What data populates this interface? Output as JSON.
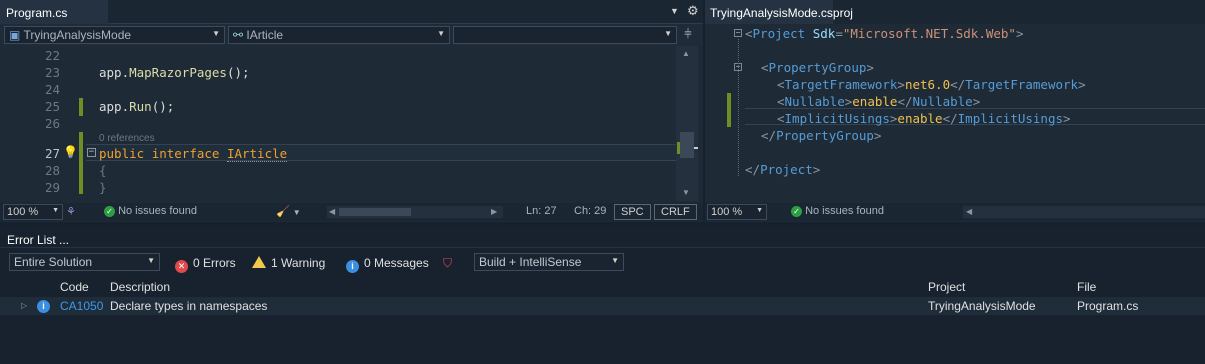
{
  "left_editor": {
    "tab_title": "Program.cs",
    "nav": {
      "project": "TryingAnalysisMode",
      "type": "IArticle",
      "member": ""
    },
    "lines": [
      {
        "num": "22",
        "text": ""
      },
      {
        "num": "23",
        "obj": "app",
        "method": "MapRazorPages",
        "tail": "();"
      },
      {
        "num": "24",
        "text": ""
      },
      {
        "num": "25",
        "obj": "app",
        "method": "Run",
        "tail": "();"
      },
      {
        "num": "26",
        "text": ""
      },
      {
        "num": "27",
        "kw1": "public",
        "kw2": "interface",
        "name": "IArticle"
      },
      {
        "num": "28",
        "text": "{"
      },
      {
        "num": "29",
        "text": "}"
      }
    ],
    "codelens": "0 references",
    "status": {
      "zoom": "100 %",
      "issues": "No issues found",
      "ln": "Ln: 27",
      "ch": "Ch: 29",
      "spc": "SPC",
      "crlf": "CRLF"
    }
  },
  "right_editor": {
    "tab_title": "TryingAnalysisMode.csproj",
    "xml": {
      "project_open_tag": "Project",
      "sdk_attr": "Sdk",
      "sdk_value": "\"Microsoft.NET.Sdk.Web\"",
      "property_group": "PropertyGroup",
      "target_framework_tag": "TargetFramework",
      "target_framework_value": "net6.0",
      "nullable_tag": "Nullable",
      "nullable_value": "enable",
      "implicit_usings_tag": "ImplicitUsings",
      "implicit_usings_value": "enable",
      "project_close_tag": "Project"
    },
    "status": {
      "zoom": "100 %",
      "issues": "No issues found"
    }
  },
  "error_list": {
    "title": "Error List ...",
    "scope": "Entire Solution",
    "errors": "0 Errors",
    "warnings": "1 Warning",
    "messages": "0 Messages",
    "build_filter": "Build + IntelliSense",
    "columns": {
      "code": "Code",
      "description": "Description",
      "project": "Project",
      "file": "File"
    },
    "rows": [
      {
        "code": "CA1050",
        "description": "Declare types in namespaces",
        "project": "TryingAnalysisMode",
        "file": "Program.cs"
      }
    ]
  },
  "colors": {
    "accent_green": "#6e8f24",
    "keyword": "#f0a030",
    "xml_tag": "#569cd6",
    "link": "#3b9be8"
  }
}
